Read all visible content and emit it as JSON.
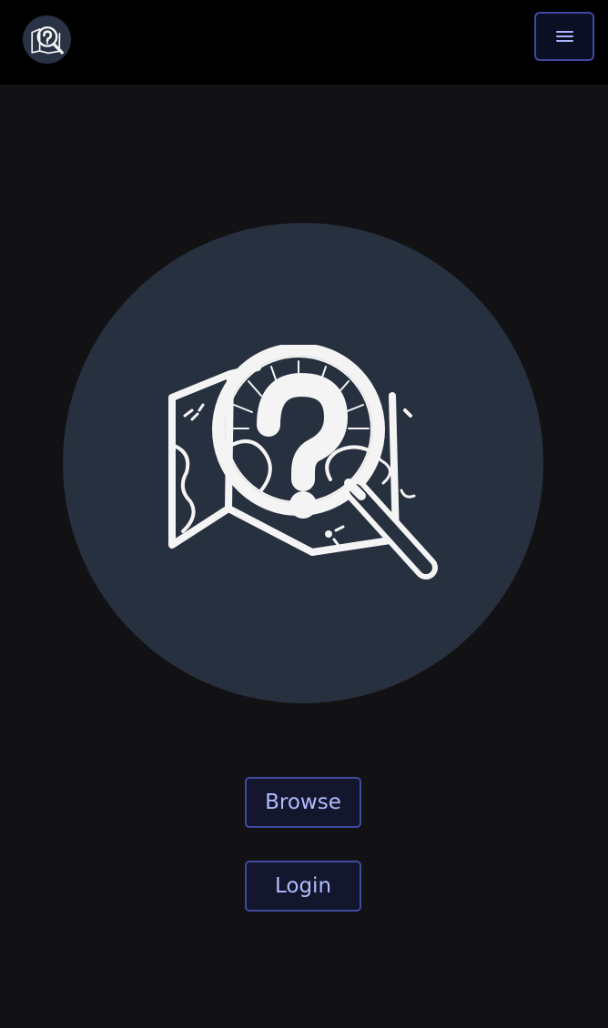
{
  "header": {
    "logo_icon": "map-question-magnifier-icon",
    "menu_icon": "hamburger-menu-icon"
  },
  "hero": {
    "illustration_icon": "map-question-magnifier-icon"
  },
  "actions": {
    "browse_label": "Browse",
    "login_label": "Login"
  },
  "colors": {
    "page_background": "#121214",
    "header_background": "#000000",
    "circle_background": "#27303f",
    "button_border": "#3f4aa0",
    "button_text": "#b2bcff"
  }
}
